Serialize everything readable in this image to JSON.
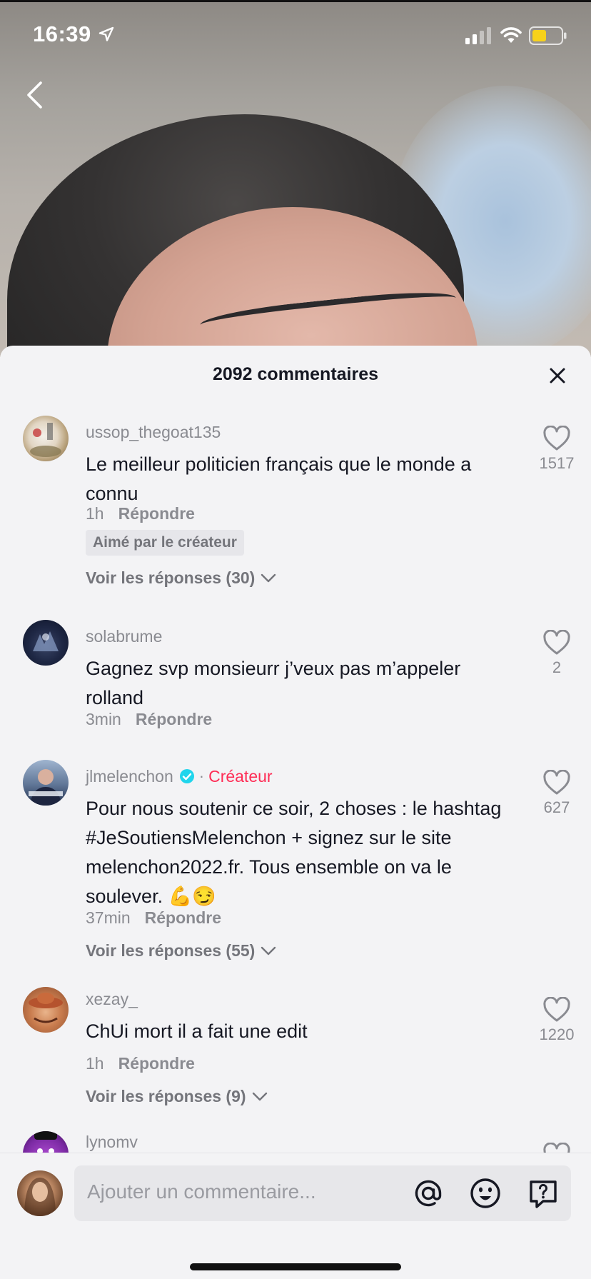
{
  "status_bar": {
    "time": "16:39"
  },
  "comments_sheet": {
    "title": "2092 commentaires",
    "comments": [
      {
        "username": "ussop_thegoat135",
        "text": "Le meilleur politicien français que le monde a connu",
        "time": "1h",
        "reply_label": "Répondre",
        "liked_by_creator": "Aimé par le créateur",
        "view_replies": "Voir les réponses (30)",
        "likes": "1517"
      },
      {
        "username": "solabrume",
        "text": "Gagnez svp monsieurr j’veux pas m’appeler rolland",
        "time": "3min",
        "reply_label": "Répondre",
        "likes": "2"
      },
      {
        "username": "jlmelenchon",
        "creator_label": "Créateur",
        "separator": "·",
        "text": "Pour nous soutenir ce soir, 2 choses : le hashtag #JeSoutiensMelenchon + signez sur le site melenchon2022.fr. Tous ensemble on va le soulever. 💪😏",
        "time": "37min",
        "reply_label": "Répondre",
        "view_replies": "Voir les réponses (55)",
        "likes": "627"
      },
      {
        "username": "xezay_",
        "text": "ChUi mort il a fait une edit",
        "time": "1h",
        "reply_label": "Répondre",
        "view_replies": "Voir les réponses (9)",
        "likes": "1220"
      },
      {
        "username": "lynomv"
      }
    ]
  },
  "input_bar": {
    "placeholder": "Ajouter un commentaire..."
  },
  "icons": [
    "location-icon",
    "signal-icon",
    "wifi-icon",
    "battery-icon",
    "back-chevron-icon",
    "close-icon",
    "heart-icon",
    "chevron-down-icon",
    "verified-icon",
    "at-mention-icon",
    "emoji-icon",
    "question-icon"
  ],
  "colors": {
    "accent_creator": "#fe2c55",
    "verified": "#20d5ec",
    "battery": "#f7d21b"
  }
}
